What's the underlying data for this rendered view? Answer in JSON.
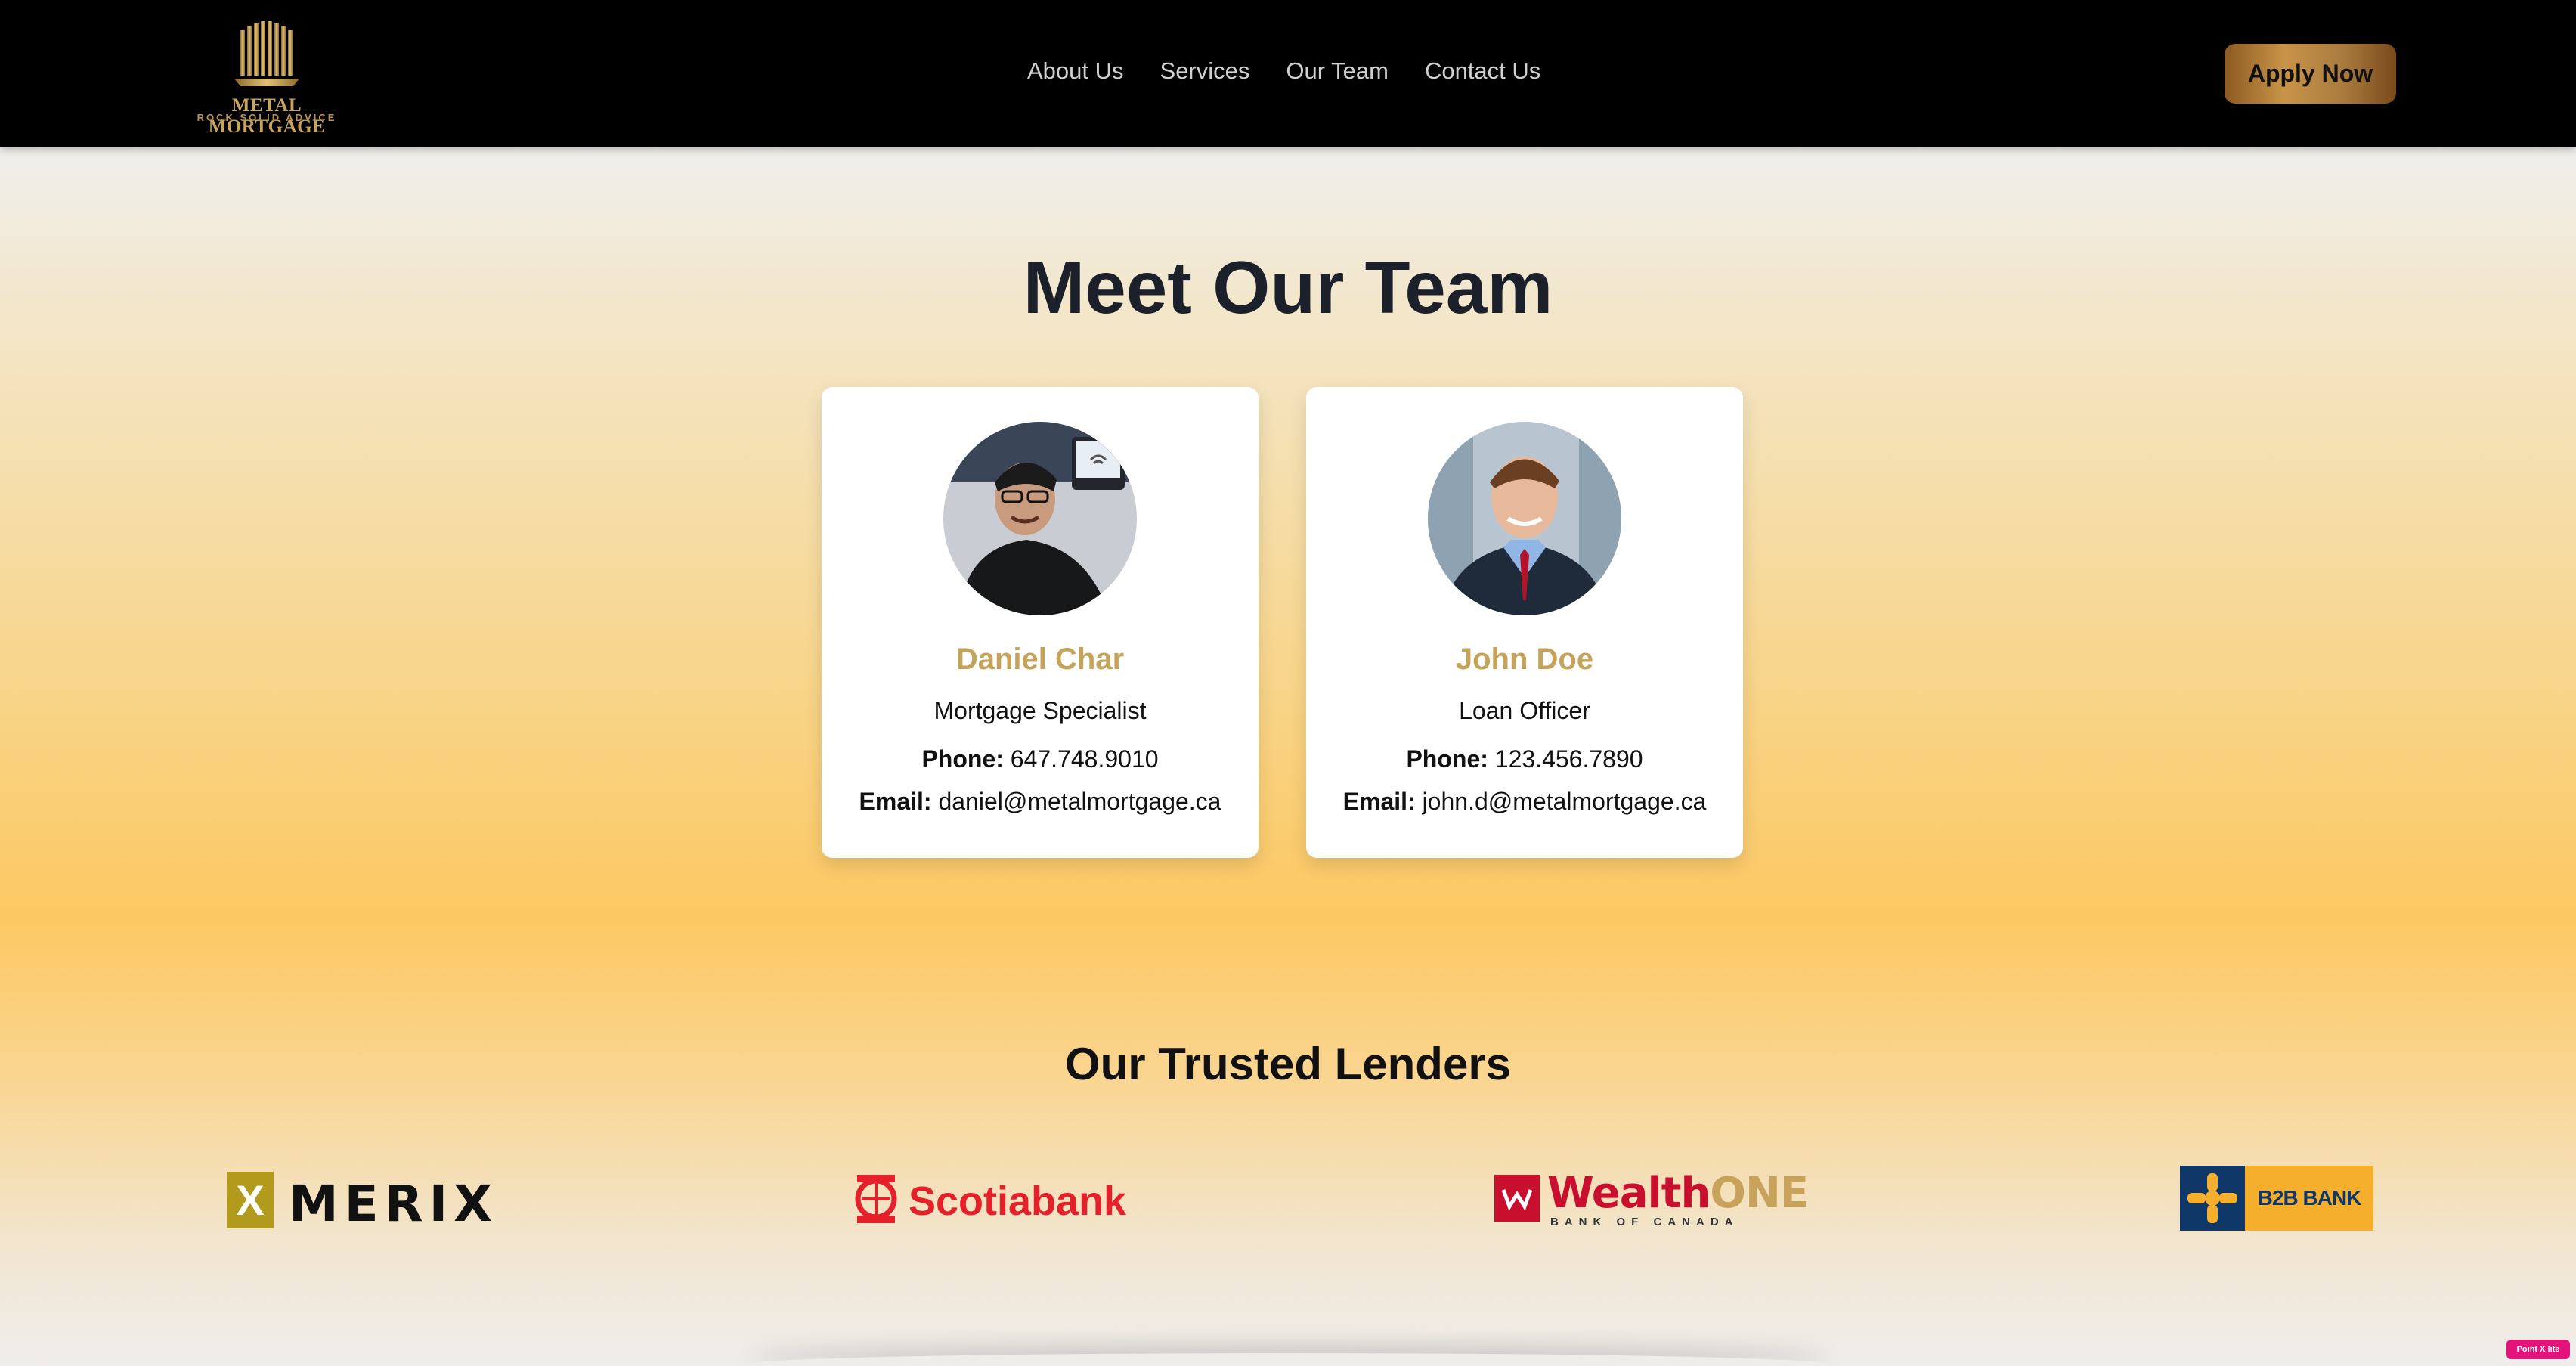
{
  "brand": {
    "name": "METAL MORTGAGE",
    "tagline": "ROCK SOLID ADVICE",
    "logo_icon": "building-icon",
    "accent": "#c5a35a"
  },
  "nav": {
    "items": [
      {
        "label": "About Us"
      },
      {
        "label": "Services"
      },
      {
        "label": "Our Team"
      },
      {
        "label": "Contact Us"
      }
    ],
    "apply_label": "Apply Now"
  },
  "team": {
    "title": "Meet Our Team",
    "members": [
      {
        "name": "Daniel Char",
        "role": "Mortgage Specialist",
        "phone_label": "Phone:",
        "phone": "647.748.9010",
        "email_label": "Email:",
        "email": "daniel@metalmortgage.ca"
      },
      {
        "name": "John Doe",
        "role": "Loan Officer",
        "phone_label": "Phone:",
        "phone": "123.456.7890",
        "email_label": "Email:",
        "email": "john.d@metalmortgage.ca"
      }
    ]
  },
  "lenders": {
    "title": "Our Trusted Lenders",
    "items": [
      {
        "name": "MERIX",
        "mark": "X"
      },
      {
        "name": "Scotiabank"
      },
      {
        "name_a": "Wealth",
        "name_b": "ONE",
        "sub": "BANK OF CANADA"
      },
      {
        "name": "B2B BANK"
      }
    ]
  },
  "badge": {
    "label": "Point X lite"
  }
}
